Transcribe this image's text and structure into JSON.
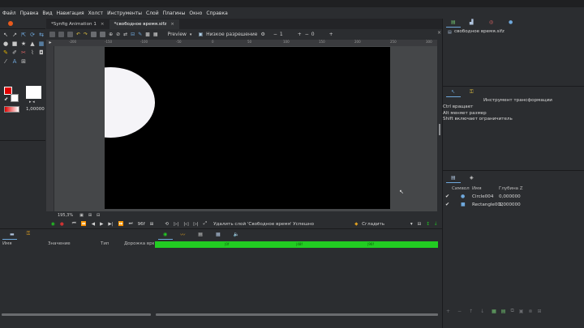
{
  "menu": [
    "Файл",
    "Правка",
    "Вид",
    "Навигация",
    "Холст",
    "Инструменты",
    "Слой",
    "Плагины",
    "Окно",
    "Справка"
  ],
  "tabs": [
    {
      "label": "*Synfig Animation 1",
      "active": false
    },
    {
      "label": "*свободное время.sifz",
      "active": true
    }
  ],
  "canvas_toolbar": {
    "preview_label": "Preview",
    "quality_label": "Низкое разрешение",
    "field1_value": "1",
    "field2_value": "0"
  },
  "ruler_h_ticks": [
    "-200",
    "-150",
    "-100",
    "-50",
    "0",
    "50",
    "100",
    "150",
    "200",
    "250",
    "300"
  ],
  "colors": {
    "outline_color": "#e00000",
    "fill_color": "#ffffff",
    "accent_green": "#22cc22",
    "canvas_bg": "#000000"
  },
  "toolbox": {
    "brush_size": "1,00000",
    "tool_icons": [
      "circle-icon",
      "rectangle-icon",
      "star-icon",
      "polygon-icon",
      "gradient-icon",
      "transform-icon",
      "smooth-move-icon",
      "scale-icon",
      "rotate-icon",
      "mirror-icon",
      "spline-icon",
      "draw-icon",
      "cutout-icon",
      "width-icon",
      "fill-icon",
      "eyedrop-icon",
      "text-icon",
      "sketch-icon",
      "brush-icon",
      "zoom-icon"
    ]
  },
  "status": {
    "zoom": "195,3%",
    "frame": "96f",
    "message": "Удалить слой 'Свободное время' Успешно",
    "interpolation": "Сгладить",
    "frame_field": "0"
  },
  "params_panel": {
    "columns": [
      "Имя",
      "Значение",
      "Тип",
      "Дорожка врем"
    ]
  },
  "timetrack": {
    "ticks": [
      "|0f",
      "|48f",
      "|96f"
    ]
  },
  "right_top": {
    "file": "свободное время.sifz"
  },
  "tool_options": {
    "title": "Инструмент трансформации",
    "lines": [
      "Ctrl вращает",
      "Alt меняет размер",
      "Shift включает ограничитель"
    ]
  },
  "layers_panel": {
    "columns": [
      "Символ",
      "Имя",
      "Глубина Z"
    ],
    "rows": [
      {
        "name": "Circle004",
        "depth": "0,000000"
      },
      {
        "name": "Rectangle002",
        "depth": "1,000000"
      }
    ]
  }
}
